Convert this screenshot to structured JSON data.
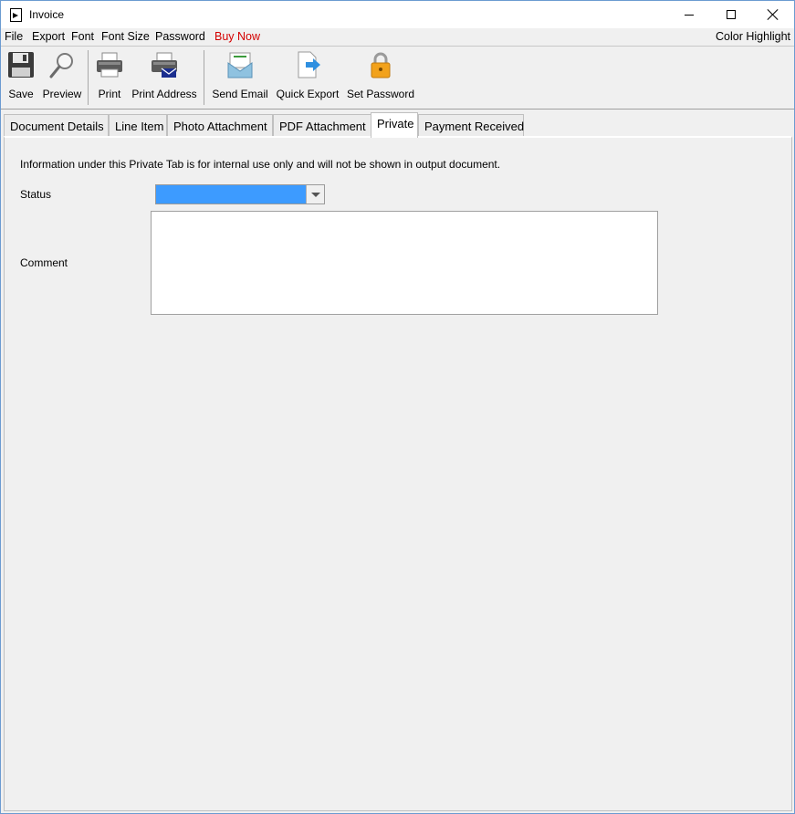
{
  "window": {
    "title": "Invoice"
  },
  "menu": {
    "items": [
      {
        "label": "File",
        "color": "#000000"
      },
      {
        "label": "Export",
        "color": "#000000"
      },
      {
        "label": "Font",
        "color": "#000000"
      },
      {
        "label": "Font Size",
        "color": "#000000"
      },
      {
        "label": "Password",
        "color": "#000000"
      },
      {
        "label": "Buy Now",
        "color": "#d40000"
      }
    ],
    "right_label": "Color Highlight"
  },
  "toolbar": {
    "items": [
      {
        "label": "Save",
        "icon": "floppy-disk-icon"
      },
      {
        "label": "Preview",
        "icon": "magnifier-icon"
      },
      {
        "label": "Print",
        "icon": "printer-icon"
      },
      {
        "label": "Print Address",
        "icon": "printer-envelope-icon"
      },
      {
        "label": "Send Email",
        "icon": "email-icon"
      },
      {
        "label": "Quick Export",
        "icon": "export-document-icon"
      },
      {
        "label": "Set Password",
        "icon": "padlock-icon"
      }
    ]
  },
  "tabs": {
    "items": [
      {
        "label": "Document Details"
      },
      {
        "label": "Line Item"
      },
      {
        "label": "Photo Attachment"
      },
      {
        "label": "PDF Attachment"
      },
      {
        "label": "Private"
      },
      {
        "label": "Payment Received"
      }
    ],
    "active": "Private"
  },
  "private_tab": {
    "info_text": "Information under this Private Tab is for internal use only and will not be shown in output document.",
    "status_label": "Status",
    "status_value": "",
    "comment_label": "Comment",
    "comment_value": ""
  },
  "colors": {
    "status_highlight": "#3d9bff",
    "buy_now": "#d40000"
  }
}
